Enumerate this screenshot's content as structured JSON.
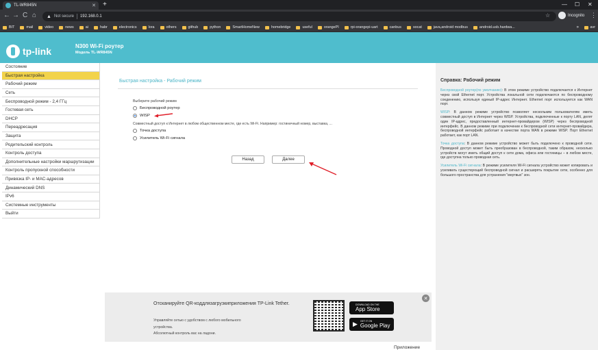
{
  "browser": {
    "tab_title": "TL-WR845N",
    "tab_close": "✕",
    "new_tab": "+",
    "win_min": "—",
    "win_max": "☐",
    "win_close": "✕",
    "back": "←",
    "forward": "→",
    "reload": "C",
    "home": "⌂",
    "warning_icon": "▲",
    "not_secure": "Not secure",
    "url": "192.168.0.1",
    "star_icon": "☆",
    "incognito_label": "Incognito",
    "menu_icon": "⋮",
    "bookmarks": [
      "BIT",
      "mail",
      "video",
      "news",
      "ai",
      "habr",
      "electronics",
      "lora",
      "others",
      "github",
      "python",
      "SmartHomeNew",
      "homebridge",
      "useful",
      "orangePI",
      "rpi-orangepi-uart",
      "canbus",
      "socat",
      "java,android modbus",
      "android.usb.hardwa..."
    ],
    "bookmarks_more": "»",
    "other_bookmarks": "avr",
    "folder_color": "#f3c14c"
  },
  "header": {
    "logo_text": "tp-link",
    "model_title": "N300 Wi-Fi роутер",
    "model_sub": "Модель TL-WR845N",
    "bg_color": "#4fbdcd"
  },
  "sidebar": {
    "items": [
      "Состояние",
      "Быстрая настройка",
      "Рабочий режим",
      "Сеть",
      "Беспроводной режим - 2,4 ГГц",
      "Гостевая сеть",
      "DHCP",
      "Переадресация",
      "Защита",
      "Родительский контроль",
      "Контроль доступа",
      "Дополнительные настройки маршрутизации",
      "Контроль пропускной способности",
      "Привязка IP- и MAC-адресов",
      "Динамический DNS",
      "IPv6",
      "Системные инструменты",
      "Выйти"
    ],
    "active_index": 1,
    "active_color": "#f2d34b"
  },
  "main": {
    "title": "Быстрая настройка - Рабочий режим",
    "prompt": "Выберите рабочий режим",
    "modes": [
      {
        "label": "Беспроводной роутер",
        "checked": false
      },
      {
        "label": "WISP",
        "checked": true
      },
      {
        "label": "Точка доступа",
        "checked": false
      },
      {
        "label": "Усилитель Wi-Fi сигнала",
        "checked": false
      }
    ],
    "wisp_desc": "Совместный доступ к Интернет в любом общественном месте, где есть Wi-Fi. Например: гостиничный номер, выставка, ...",
    "back_button": "Назад",
    "next_button": "Далее"
  },
  "help": {
    "title": "Справка: Рабочий режим",
    "paragraphs": [
      {
        "term": "Беспроводной роутер(по умолчанию)",
        "text": ": В этом режиме устройство подключается к Интернет через свой Ethernet порт. Устройства локальной сети подключаются по беспроводному соединению, используя единый IP-адрес Интернет. Ethernet порт используется как WAN порт."
      },
      {
        "term": "WISP",
        "text": ": В данном режиме устройство позволяет нескольким пользователям иметь совместный доступ в Интернет через WISP. Устройства, подключенные к порту LAN, делят один IP-адрес, предоставленный интернет-провайдером (WISP) через беспроводной интерфейс. В данном режиме при подключении к беспроводной сети интернет-провайдера, беспроводной интерфейс работает в качестве порта WAN в режиме WISP. Порт Ethernet работает, как порт LAN."
      },
      {
        "term": "Точка доступа",
        "text": ": В данном режиме устройство может быть подключено к проводной сети. Проводной доступ может быть преобразован в беспроводной, таким образом, несколько устройств могут иметь общий доступ к сети дома, офиса или гостиницы – в любом месте, где доступна только проводная сеть."
      },
      {
        "term": "Усилитель Wi-Fi сигнала",
        "text": ": В режиме усилителя Wi-Fi сигнала устройство может копировать и усиливать существующий беспроводной сигнал и расширять покрытие сети, особенно для большого пространства для устранения \"мертвых\" зон."
      }
    ]
  },
  "banner": {
    "heading": "Отсканируйте QR-коддлязагрузкиприложения TP-Link Tether.",
    "line1": "Управляйте сетью с удобством с любого мобильного",
    "line2": "устройства.",
    "line3": "Абсолютный контроль вас на ладони.",
    "appstore_small": "DOWNLOAD ON THE",
    "appstore_big": "App Store",
    "googleplay_small": "GET IT ON",
    "googleplay_big": "Google Play",
    "close_icon": "✕",
    "app_label": "Приложение"
  },
  "annotations": {
    "arrow_color": "#e0202a"
  }
}
